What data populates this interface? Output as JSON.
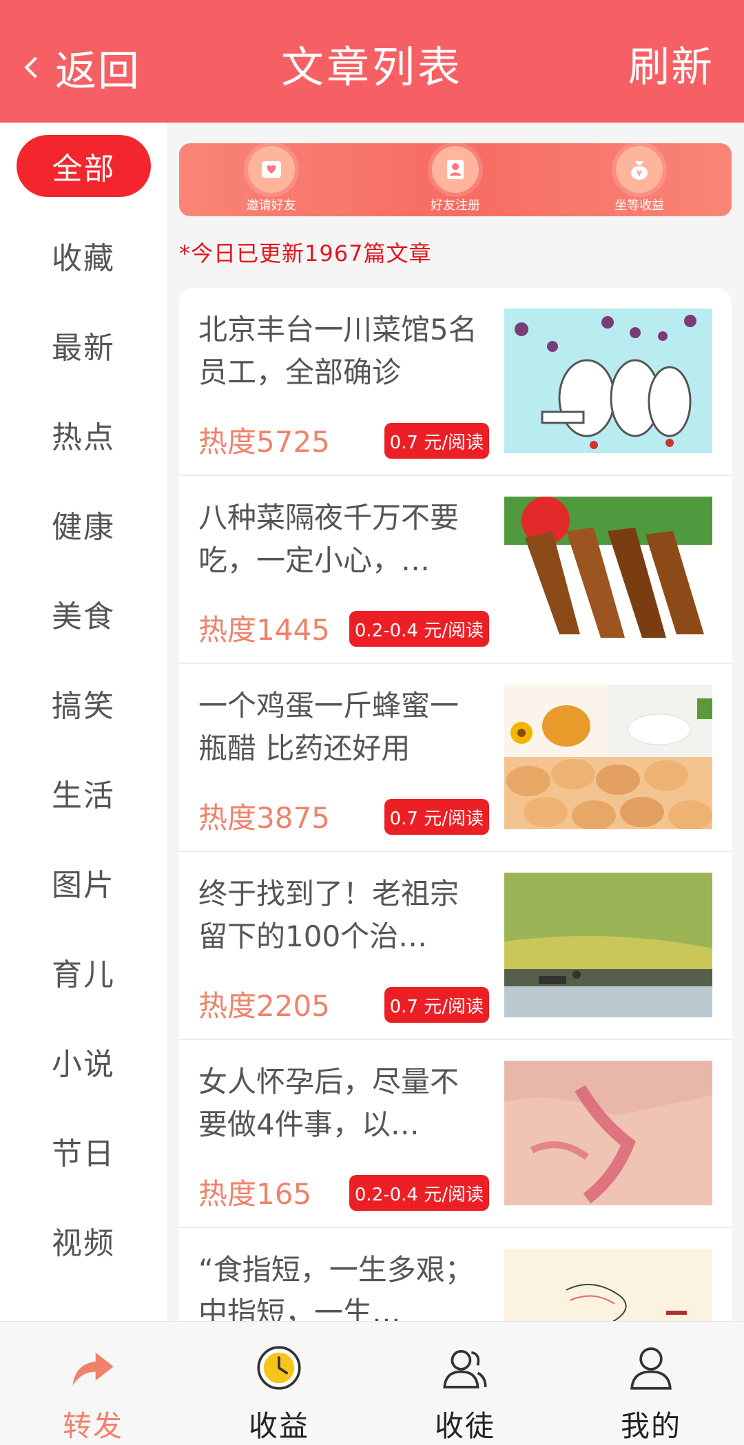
{
  "header": {
    "back_label": "返回",
    "title": "文章列表",
    "refresh_label": "刷新",
    "color": "#f66064"
  },
  "sidebar": {
    "items": [
      {
        "label": "全部",
        "active": true
      },
      {
        "label": "收藏"
      },
      {
        "label": "最新"
      },
      {
        "label": "热点"
      },
      {
        "label": "健康"
      },
      {
        "label": "美食"
      },
      {
        "label": "搞笑"
      },
      {
        "label": "生活"
      },
      {
        "label": "图片"
      },
      {
        "label": "育儿"
      },
      {
        "label": "小说"
      },
      {
        "label": "节日"
      },
      {
        "label": "视频"
      }
    ]
  },
  "banner": {
    "items": [
      {
        "label": "邀请好友",
        "icon": "invite-icon"
      },
      {
        "label": "好友注册",
        "icon": "register-icon"
      },
      {
        "label": "坐等收益",
        "icon": "money-bag-icon"
      }
    ]
  },
  "notice": "*今日已更新1967篇文章",
  "articles": [
    {
      "title": "北京丰台一川菜馆5名员工，全部确诊",
      "heat": "热度5725",
      "price": "0.7 元/阅读",
      "thumb": "medics-illustration"
    },
    {
      "title": "八种菜隔夜千万不要吃，一定小心，…",
      "heat": "热度1445",
      "price": "0.2-0.4 元/阅读",
      "thumb": "braised-duck-dish"
    },
    {
      "title": "一个鸡蛋一斤蜂蜜一瓶醋 比药还好用",
      "heat": "热度3875",
      "price": "0.7 元/阅读",
      "thumb": "eggs-honey"
    },
    {
      "title": "终于找到了！老祖宗留下的100个治…",
      "heat": "热度2205",
      "price": "0.7 元/阅读",
      "thumb": "farm-field"
    },
    {
      "title": "女人怀孕后，尽量不要做4件事，以…",
      "heat": "热度165",
      "price": "0.2-0.4 元/阅读",
      "thumb": "hand-rash"
    },
    {
      "title": "“食指短，一生多艰；中指短，一生…",
      "heat": "",
      "price": "",
      "thumb": "palm-sketch"
    }
  ],
  "tabbar": {
    "items": [
      {
        "label": "转发",
        "icon": "share-arrow-icon",
        "active": true
      },
      {
        "label": "收益",
        "icon": "clock-icon"
      },
      {
        "label": "收徒",
        "icon": "users-icon"
      },
      {
        "label": "我的",
        "icon": "user-icon"
      }
    ]
  }
}
